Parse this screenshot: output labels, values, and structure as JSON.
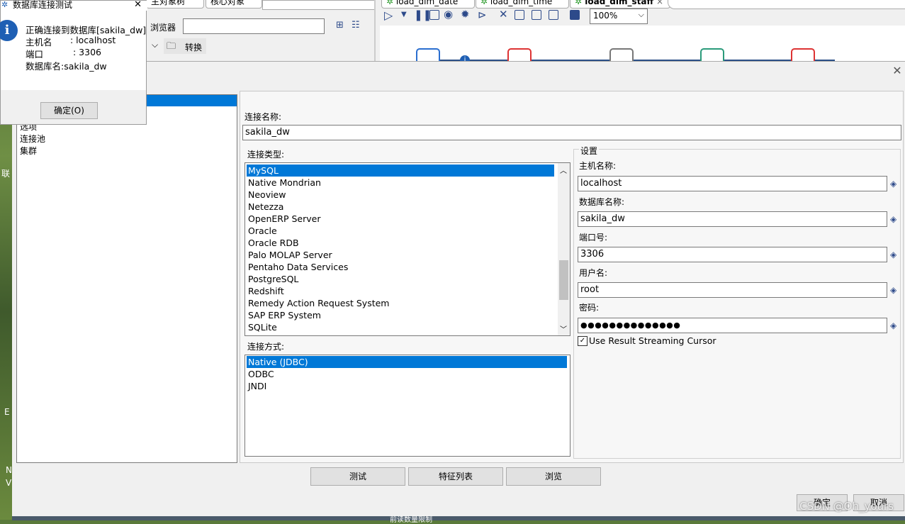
{
  "background_ide": {
    "tabs_left": [
      "主对象树",
      "核心对象"
    ],
    "browser_label": "浏览器",
    "tree_item": "转换",
    "tabs_right": [
      "load_dim_date",
      "load_dim_time",
      "load_dim_staff"
    ],
    "zoom": "100%",
    "desktop_fragments": [
      "联",
      "E",
      "N",
      "V"
    ]
  },
  "message_box": {
    "title": "数据库连接测试",
    "line1": "正确连接到数据库[sakila_dw]",
    "host_label": "主机名",
    "host_value": ": localhost",
    "port_label": "端口",
    "port_value": ": 3306",
    "db_line": "数据库名:sakila_dw",
    "ok_button": "确定(O)"
  },
  "dialog": {
    "left_nav": [
      "选项",
      "连接池",
      "集群"
    ],
    "conn_name_label": "连接名称:",
    "conn_name_value": "sakila_dw",
    "conn_type_label": "连接类型:",
    "conn_types": [
      "MySQL",
      "Native Mondrian",
      "Neoview",
      "Netezza",
      "OpenERP Server",
      "Oracle",
      "Oracle RDB",
      "Palo MOLAP Server",
      "Pentaho Data Services",
      "PostgreSQL",
      "Redshift",
      "Remedy Action Request System",
      "SAP ERP System",
      "SQLite"
    ],
    "conn_type_selected": "MySQL",
    "access_label": "连接方式:",
    "access_methods": [
      "Native (JDBC)",
      "ODBC",
      "JNDI"
    ],
    "access_selected": "Native (JDBC)",
    "settings_label": "设置",
    "host_label": "主机名称:",
    "host_value": "localhost",
    "db_label": "数据库名称:",
    "db_value": "sakila_dw",
    "port_label": "端口号:",
    "port_value": "3306",
    "user_label": "用户名:",
    "user_value": "root",
    "password_label": "密码:",
    "password_value": "●●●●●●●●●●●●●●",
    "streaming_label": "Use Result Streaming Cursor",
    "streaming_checked": true,
    "buttons": {
      "test": "测试",
      "features": "特征列表",
      "browse": "浏览"
    },
    "bottom_buttons": {
      "ok": "确定",
      "cancel": "取消"
    },
    "bottom_partial_text": "前读数量限制"
  },
  "watermark": "CSDN @Oh_yours",
  "colors": {
    "selection": "#0078d7",
    "dialog_bg": "#f0f0f0",
    "info_icon": "#1e5fb4"
  }
}
